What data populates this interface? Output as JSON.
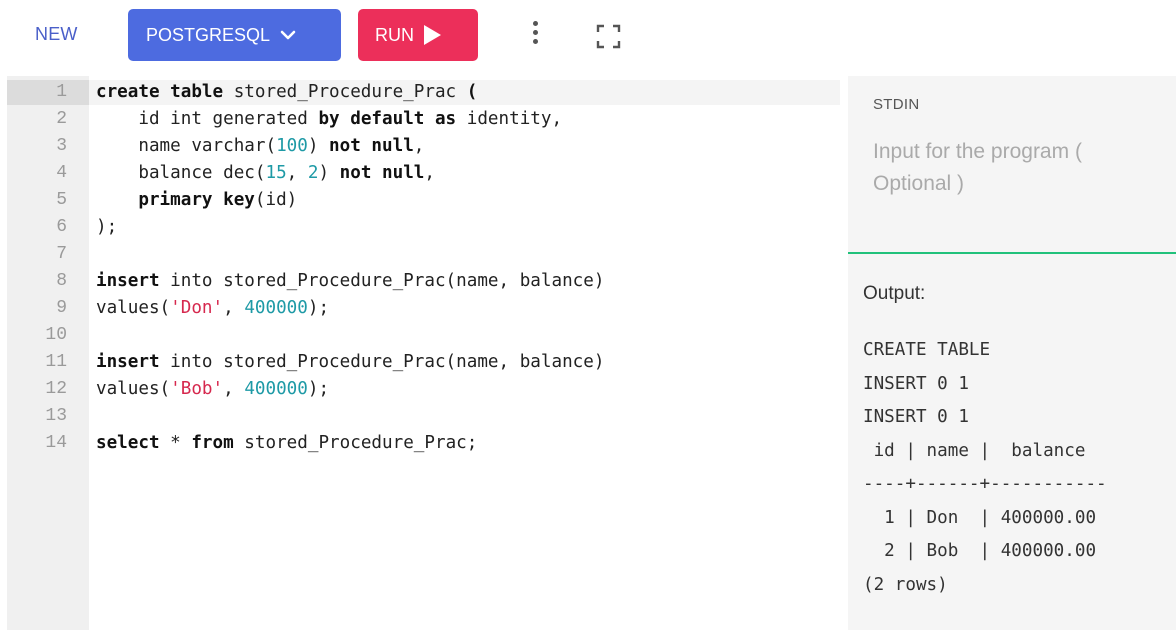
{
  "toolbar": {
    "new_label": "NEW",
    "language_label": "POSTGRESQL",
    "run_label": "RUN",
    "colors": {
      "language_button": "#4d6be0",
      "run_button": "#ec2f5a",
      "new_text": "#4a5fc9"
    }
  },
  "editor": {
    "line_numbers": [
      "1",
      "2",
      "3",
      "4",
      "5",
      "6",
      "7",
      "8",
      "9",
      "10",
      "11",
      "12",
      "13",
      "14"
    ],
    "lines": [
      [
        {
          "t": "create table",
          "c": "kw"
        },
        {
          "t": " stored_Procedure_Prac ",
          "c": ""
        },
        {
          "t": "(",
          "c": "kw"
        }
      ],
      [
        {
          "t": "    id int generated ",
          "c": ""
        },
        {
          "t": "by default as",
          "c": "kw"
        },
        {
          "t": " identity,",
          "c": ""
        }
      ],
      [
        {
          "t": "    name varchar(",
          "c": ""
        },
        {
          "t": "100",
          "c": "num"
        },
        {
          "t": ") ",
          "c": ""
        },
        {
          "t": "not null",
          "c": "kw"
        },
        {
          "t": ",",
          "c": ""
        }
      ],
      [
        {
          "t": "    balance dec(",
          "c": ""
        },
        {
          "t": "15",
          "c": "num"
        },
        {
          "t": ", ",
          "c": ""
        },
        {
          "t": "2",
          "c": "num"
        },
        {
          "t": ") ",
          "c": ""
        },
        {
          "t": "not null",
          "c": "kw"
        },
        {
          "t": ",",
          "c": ""
        }
      ],
      [
        {
          "t": "    ",
          "c": ""
        },
        {
          "t": "primary key",
          "c": "kw"
        },
        {
          "t": "(id)",
          "c": ""
        }
      ],
      [
        {
          "t": ");",
          "c": ""
        }
      ],
      [],
      [
        {
          "t": "insert",
          "c": "kw"
        },
        {
          "t": " into stored_Procedure_Prac(name, balance)",
          "c": ""
        }
      ],
      [
        {
          "t": "values(",
          "c": ""
        },
        {
          "t": "'Don'",
          "c": "str"
        },
        {
          "t": ", ",
          "c": ""
        },
        {
          "t": "400000",
          "c": "num"
        },
        {
          "t": ");",
          "c": ""
        }
      ],
      [],
      [
        {
          "t": "insert",
          "c": "kw"
        },
        {
          "t": " into stored_Procedure_Prac(name, balance)",
          "c": ""
        }
      ],
      [
        {
          "t": "values(",
          "c": ""
        },
        {
          "t": "'Bob'",
          "c": "str"
        },
        {
          "t": ", ",
          "c": ""
        },
        {
          "t": "400000",
          "c": "num"
        },
        {
          "t": ");",
          "c": ""
        }
      ],
      [],
      [
        {
          "t": "select",
          "c": "kw"
        },
        {
          "t": " * ",
          "c": ""
        },
        {
          "t": "from",
          "c": "kw"
        },
        {
          "t": " stored_Procedure_Prac;",
          "c": ""
        }
      ]
    ]
  },
  "stdin": {
    "label": "STDIN",
    "placeholder": "Input for the program ( Optional )",
    "value": ""
  },
  "output": {
    "label": "Output:",
    "text": "CREATE TABLE\nINSERT 0 1\nINSERT 0 1\n id | name |  balance\n----+------+-----------\n  1 | Don  | 400000.00\n  2 | Bob  | 400000.00\n(2 rows)",
    "divider_color": "#21c17b"
  }
}
